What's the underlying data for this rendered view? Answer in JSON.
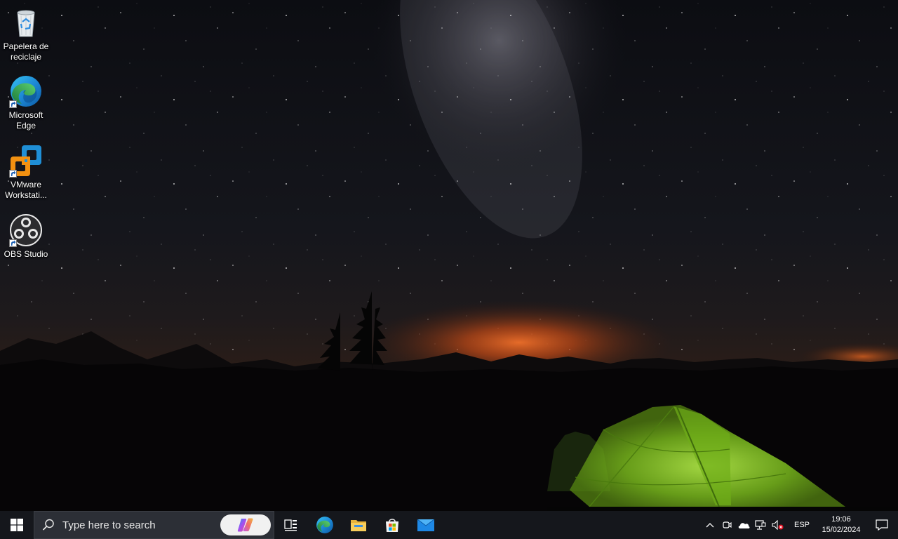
{
  "desktop": {
    "icons": [
      {
        "label": "Papelera de reciclaje",
        "icon": "recycle-bin-icon"
      },
      {
        "label": "Microsoft Edge",
        "icon": "edge-icon"
      },
      {
        "label": "VMware Workstati...",
        "icon": "vmware-icon"
      },
      {
        "label": "OBS Studio",
        "icon": "obs-icon"
      }
    ]
  },
  "taskbar": {
    "search_placeholder": "Type here to search",
    "apps": [
      "task-view-icon",
      "edge-icon",
      "file-explorer-icon",
      "microsoft-store-icon",
      "mail-icon"
    ],
    "tray": {
      "language": "ESP",
      "time": "19:06",
      "date": "15/02/2024"
    }
  },
  "colors": {
    "taskbar_bg": "#15171c",
    "search_bg": "#2c2f36",
    "tent_green": "#8fd42a",
    "horizon_orange": "#e8651c"
  }
}
